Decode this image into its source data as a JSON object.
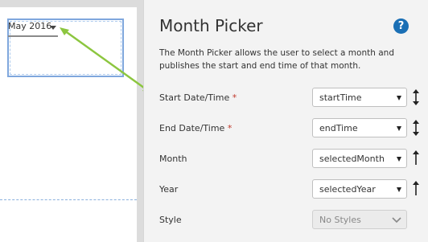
{
  "canvas": {
    "widget": {
      "value": "May 2016"
    }
  },
  "panel": {
    "title": "Month Picker",
    "help": "?",
    "description": "The Month Picker allows the user to select a month and publishes the start and end time of that month.",
    "rows": [
      {
        "label": "Start Date/Time",
        "required": "*",
        "value": "startTime",
        "icon": "bidirectional-arrow-icon"
      },
      {
        "label": "End Date/Time",
        "required": "*",
        "value": "endTime",
        "icon": "bidirectional-arrow-icon"
      },
      {
        "label": "Month",
        "required": "",
        "value": "selectedMonth",
        "icon": "up-arrow-icon"
      },
      {
        "label": "Year",
        "required": "",
        "value": "selectedYear",
        "icon": "up-arrow-icon"
      },
      {
        "label": "Style",
        "required": "",
        "value": "No Styles",
        "icon": "chevron-down-icon"
      }
    ]
  },
  "colors": {
    "accent_arrow": "#8cc63f",
    "help_blue": "#1a6fb5",
    "required_red": "#c0392b",
    "selection_blue": "#7fa7dd"
  }
}
